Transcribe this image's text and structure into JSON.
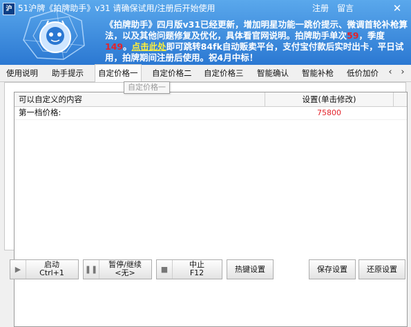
{
  "window": {
    "logo_text": "沪",
    "title": "51沪牌《拍牌助手》v31 请确保试用/注册后开始使用",
    "register": "注册",
    "message": "留言",
    "close_glyph": "✕"
  },
  "announcement": {
    "p1": "《拍牌助手》四月版v31已经更新，增加明星功能一跳价提示、微调首轮补枪算法，以及其他问题修复及优化，具体看官网说明。拍牌助手单次",
    "price_single": "59",
    "p2": "，季度",
    "price_quarter": "149",
    "p3": "。",
    "link": "点击此处",
    "p4": "即可跳转84fk自动贩卖平台，支付宝付款后实时出卡，平日试用，拍牌期间注册后使用。祝4月中标！"
  },
  "tabs": [
    {
      "label": "使用说明"
    },
    {
      "label": "助手提示"
    },
    {
      "label": "自定价格一"
    },
    {
      "label": "自定价格二"
    },
    {
      "label": "自定价格三"
    },
    {
      "label": "智能确认"
    },
    {
      "label": "智能补枪"
    },
    {
      "label": "低价加价"
    }
  ],
  "tab_nav": {
    "prev": "‹",
    "next": "›"
  },
  "tooltip": "自定价格一",
  "grid": {
    "columns": [
      "可以自定义的内容",
      "设置(单击修改)"
    ],
    "rows": [
      {
        "label": "第一档价格:",
        "value": "75800"
      }
    ]
  },
  "toolbar": {
    "start": {
      "label": "启动",
      "shortcut": "Ctrl+1",
      "icon": "play-icon"
    },
    "pause": {
      "label": "暂停/继续",
      "shortcut": "<无>",
      "icon": "pause-icon"
    },
    "stop": {
      "label": "中止",
      "shortcut": "F12",
      "icon": "stop-icon"
    },
    "hotkeys": "热键设置",
    "save": "保存设置",
    "restore": "还原设置"
  },
  "colors": {
    "banner_top": "#5aa8ec",
    "banner_bottom": "#2b78d2",
    "price_red": "#e3232a",
    "link_yellow": "#ffef3a"
  }
}
